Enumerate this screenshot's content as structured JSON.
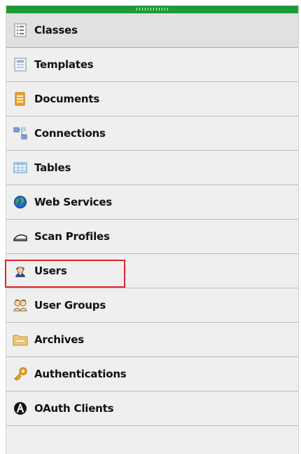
{
  "navigation": {
    "items": [
      {
        "label": "Classes",
        "icon": "classes-list-icon",
        "selected": true
      },
      {
        "label": "Templates",
        "icon": "templates-icon",
        "selected": false
      },
      {
        "label": "Documents",
        "icon": "documents-icon",
        "selected": false
      },
      {
        "label": "Connections",
        "icon": "connections-icon",
        "selected": false
      },
      {
        "label": "Tables",
        "icon": "tables-icon",
        "selected": false
      },
      {
        "label": "Web Services",
        "icon": "globe-icon",
        "selected": false
      },
      {
        "label": "Scan Profiles",
        "icon": "scanner-icon",
        "selected": false
      },
      {
        "label": "Users",
        "icon": "user-icon",
        "selected": false,
        "highlighted": true
      },
      {
        "label": "User Groups",
        "icon": "user-group-icon",
        "selected": false
      },
      {
        "label": "Archives",
        "icon": "archive-folder-icon",
        "selected": false
      },
      {
        "label": "Authentications",
        "icon": "key-icon",
        "selected": false
      },
      {
        "label": "OAuth Clients",
        "icon": "oauth-icon",
        "selected": false
      }
    ]
  },
  "colors": {
    "top_bar": "#1f9a3a",
    "panel_background": "#efefef",
    "selected_background": "#e1e1e1",
    "highlight_border": "#e0262c",
    "text": "#111111"
  }
}
